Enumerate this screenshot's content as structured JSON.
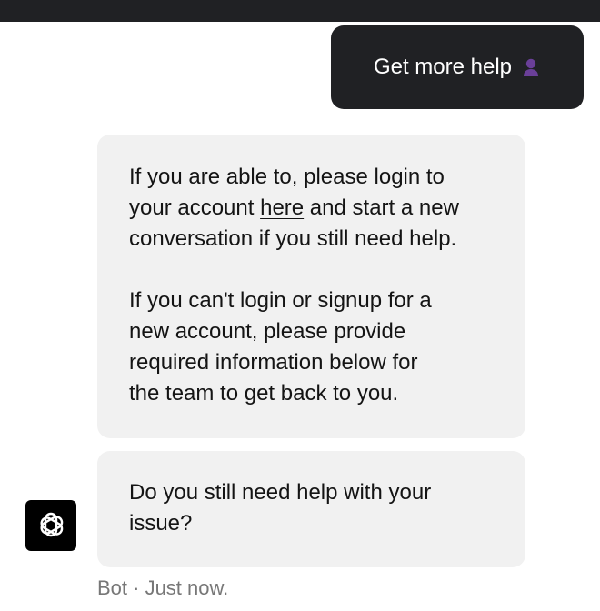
{
  "user_message": {
    "text": "Get more help",
    "icon": "person-icon"
  },
  "bot_message_1": {
    "para1_before": "If you are able to, please login to\nyour account ",
    "link_text": "here",
    "para1_after": " and start a new\nconversation if you still need help.",
    "para2": "If you can't login or signup for a\nnew account, please provide\nrequired information below for\nthe team to get back to you."
  },
  "bot_message_2": {
    "text": "Do you still need help with your\nissue?"
  },
  "bot_avatar": {
    "icon": "openai-logo-icon"
  },
  "meta": {
    "text": "Bot · Just now."
  },
  "colors": {
    "dark": "#202124",
    "bubble_bg": "#f1f1f1",
    "icon_purple": "#6a3f98",
    "meta_text": "#777777"
  }
}
